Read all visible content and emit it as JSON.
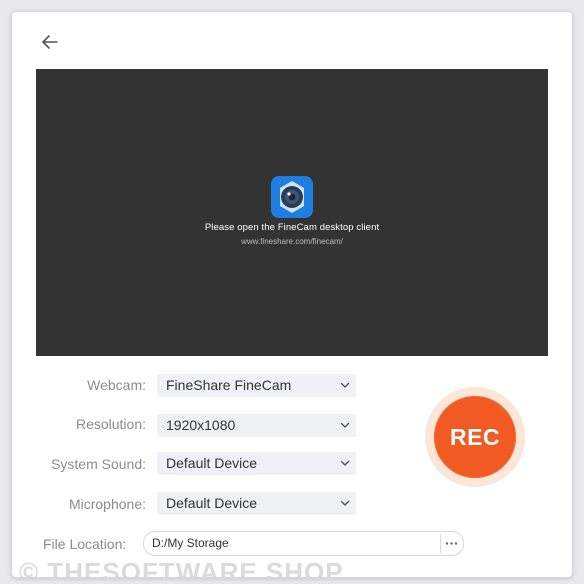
{
  "preview": {
    "message": "Please open the FineCam desktop client",
    "url": "www.fineshare.com/finecam/"
  },
  "settings": {
    "webcam": {
      "label": "Webcam:",
      "value": "FineShare FineCam"
    },
    "resolution": {
      "label": "Resolution:",
      "value": "1920x1080"
    },
    "system_sound": {
      "label": "System Sound:",
      "value": "Default Device"
    },
    "microphone": {
      "label": "Microphone:",
      "value": "Default Device"
    },
    "file_location": {
      "label": "File Location:",
      "value": "D:/My Storage"
    }
  },
  "rec_button": {
    "label": "REC"
  },
  "watermark": {
    "text": "© THESOFTWARE.SHOP"
  },
  "icons": {
    "back": "arrow-left-icon",
    "app_logo": "finecam-logo-icon",
    "dropdown": "chevron-down-icon",
    "more": "more-dots-icon"
  },
  "colors": {
    "accent": "#f15a22",
    "accent_ring": "#fde5d8",
    "preview_bg": "#333333",
    "dropdown_bg": "#f0f1f5"
  }
}
